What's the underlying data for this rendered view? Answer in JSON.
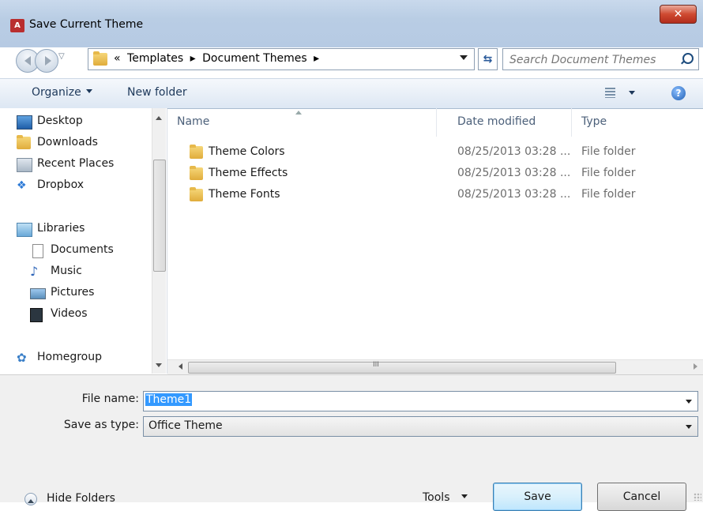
{
  "window": {
    "title": "Save Current Theme",
    "app_icon_letter": "A"
  },
  "address": {
    "crumbs": [
      "«",
      "Templates",
      "▸",
      "Document Themes",
      "▸"
    ],
    "search_placeholder": "Search Document Themes"
  },
  "toolbar": {
    "organize_label": "Organize",
    "new_folder_label": "New folder"
  },
  "nav": {
    "items": [
      {
        "label": "Desktop",
        "icon": "desktop-icon"
      },
      {
        "label": "Downloads",
        "icon": "downloads-folder-icon"
      },
      {
        "label": "Recent Places",
        "icon": "recent-places-icon"
      },
      {
        "label": "Dropbox",
        "icon": "dropbox-icon"
      },
      {
        "label": "Libraries",
        "icon": "libraries-icon"
      },
      {
        "label": "Documents",
        "icon": "documents-icon"
      },
      {
        "label": "Music",
        "icon": "music-icon"
      },
      {
        "label": "Pictures",
        "icon": "pictures-icon"
      },
      {
        "label": "Videos",
        "icon": "videos-icon"
      },
      {
        "label": "Homegroup",
        "icon": "homegroup-icon"
      }
    ]
  },
  "columns": {
    "name": "Name",
    "date": "Date modified",
    "type": "Type"
  },
  "files": [
    {
      "name": "Theme Colors",
      "date": "08/25/2013 03:28 ...",
      "type": "File folder"
    },
    {
      "name": "Theme Effects",
      "date": "08/25/2013 03:28 ...",
      "type": "File folder"
    },
    {
      "name": "Theme Fonts",
      "date": "08/25/2013 03:28 ...",
      "type": "File folder"
    }
  ],
  "form": {
    "file_name_label": "File name:",
    "file_name_value": "Theme1",
    "save_type_label": "Save as type:",
    "save_type_value": "Office Theme"
  },
  "footer": {
    "hide_folders_label": "Hide Folders",
    "tools_label": "Tools",
    "save_label": "Save",
    "cancel_label": "Cancel"
  }
}
